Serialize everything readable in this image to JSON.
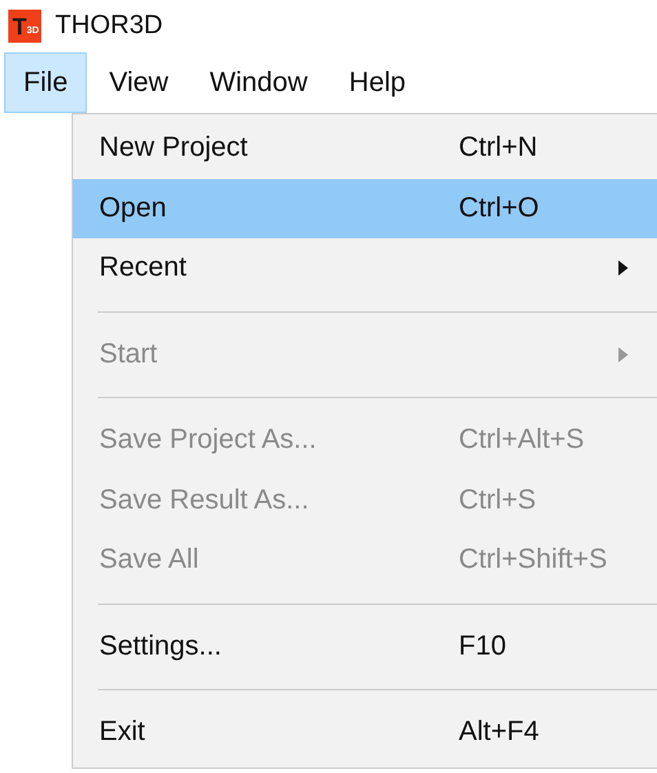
{
  "window": {
    "title": "THOR3D",
    "logo": {
      "mark": "T",
      "sub": "3D"
    }
  },
  "menu_bar": [
    {
      "label": "File",
      "selected": true
    },
    {
      "label": "View",
      "selected": false
    },
    {
      "label": "Window",
      "selected": false
    },
    {
      "label": "Help",
      "selected": false
    }
  ],
  "file_menu": [
    {
      "kind": "item",
      "label": "New Project",
      "shortcut": "Ctrl+N",
      "selected": false,
      "disabled": false
    },
    {
      "kind": "item",
      "label": "Open",
      "shortcut": "Ctrl+O",
      "selected": true,
      "disabled": false
    },
    {
      "kind": "submenu",
      "label": "Recent",
      "selected": false,
      "disabled": false
    },
    {
      "kind": "separator"
    },
    {
      "kind": "submenu",
      "label": "Start",
      "selected": false,
      "disabled": true
    },
    {
      "kind": "separator"
    },
    {
      "kind": "item",
      "label": "Save Project As...",
      "shortcut": "Ctrl+Alt+S",
      "selected": false,
      "disabled": true
    },
    {
      "kind": "item",
      "label": "Save Result As...",
      "shortcut": "Ctrl+S",
      "selected": false,
      "disabled": true
    },
    {
      "kind": "item",
      "label": "Save All",
      "shortcut": "Ctrl+Shift+S",
      "selected": false,
      "disabled": true
    },
    {
      "kind": "separator"
    },
    {
      "kind": "item",
      "label": "Settings...",
      "shortcut": "F10",
      "selected": false,
      "disabled": false
    },
    {
      "kind": "separator"
    },
    {
      "kind": "item",
      "label": "Exit",
      "shortcut": "Alt+F4",
      "selected": false,
      "disabled": false
    }
  ]
}
